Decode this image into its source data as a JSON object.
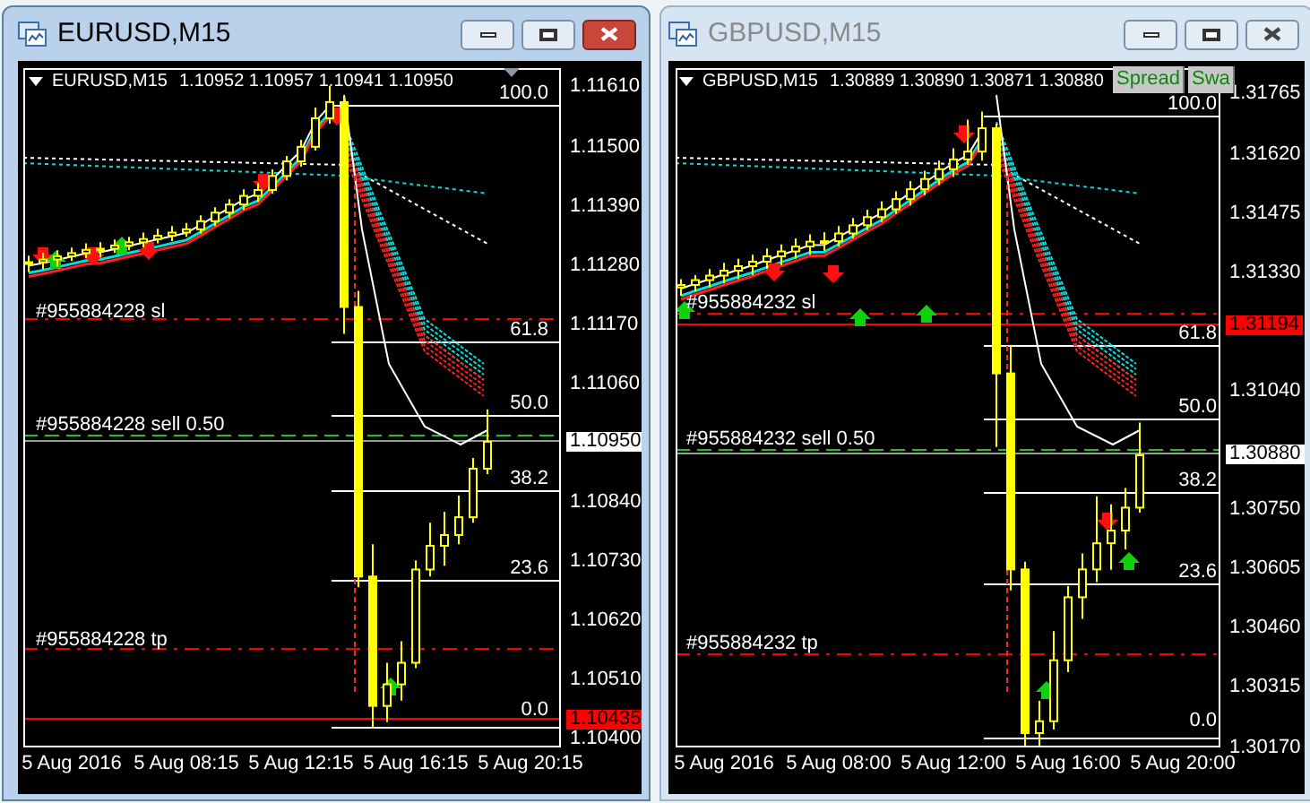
{
  "windows": [
    {
      "title": "EURUSD,M15",
      "active": true,
      "symbol": "EURUSD,M15",
      "quotes": "1.10952 1.10957 1.10941 1.10950",
      "chart_data": {
        "type": "candlestick",
        "ylim": [
          1.10383,
          1.11643
        ],
        "categories": [
          null,
          null,
          null,
          "5 Aug 2016",
          null,
          null,
          null,
          null,
          null,
          null,
          null,
          "5 Aug 08:15",
          null,
          null,
          null,
          null,
          null,
          null,
          null,
          "5 Aug 12:15",
          null,
          null,
          null,
          null,
          null,
          null,
          null,
          "5 Aug 16:15",
          null,
          null,
          null,
          null,
          null,
          null,
          null,
          "5 Aug 20:15"
        ],
        "yticks": [
          {
            "value": 1.1161,
            "label": "1.11610"
          },
          {
            "value": 1.115,
            "label": "1.11500"
          },
          {
            "value": 1.1139,
            "label": "1.11390"
          },
          {
            "value": 1.1128,
            "label": "1.11280"
          },
          {
            "value": 1.1117,
            "label": "1.11170"
          },
          {
            "value": 1.1106,
            "label": "1.11060"
          },
          {
            "value": 1.1084,
            "label": "1.10840"
          },
          {
            "value": 1.1073,
            "label": "1.10730"
          },
          {
            "value": 1.1062,
            "label": "1.10620"
          },
          {
            "value": 1.1051,
            "label": "1.10510"
          },
          {
            "value": 1.104,
            "label": "1.10400"
          }
        ],
        "ohlc": [
          [
            1.1128,
            1.11295,
            1.11265,
            1.11283
          ],
          [
            1.11283,
            1.113,
            1.1127,
            1.11288
          ],
          [
            1.11288,
            1.11305,
            1.11275,
            1.11294
          ],
          [
            1.11294,
            1.1131,
            1.11285,
            1.113
          ],
          [
            1.113,
            1.11318,
            1.1129,
            1.11306
          ],
          [
            1.11306,
            1.1132,
            1.11292,
            1.11308
          ],
          [
            1.11308,
            1.11325,
            1.113,
            1.11314
          ],
          [
            1.11314,
            1.1133,
            1.11305,
            1.1132
          ],
          [
            1.1132,
            1.11338,
            1.1131,
            1.11326
          ],
          [
            1.11326,
            1.11345,
            1.11318,
            1.11332
          ],
          [
            1.11332,
            1.1135,
            1.11322,
            1.11338
          ],
          [
            1.11338,
            1.11356,
            1.1133,
            1.11344
          ],
          [
            1.11344,
            1.1137,
            1.11336,
            1.11359
          ],
          [
            1.11359,
            1.11385,
            1.1135,
            1.11375
          ],
          [
            1.11375,
            1.114,
            1.11365,
            1.1139
          ],
          [
            1.1139,
            1.11418,
            1.1138,
            1.11406
          ],
          [
            1.11406,
            1.1143,
            1.11395,
            1.11417
          ],
          [
            1.11417,
            1.11455,
            1.1141,
            1.11443
          ],
          [
            1.11443,
            1.1148,
            1.11435,
            1.1147
          ],
          [
            1.1147,
            1.1151,
            1.1146,
            1.11497
          ],
          [
            1.11497,
            1.1157,
            1.1149,
            1.1155
          ],
          [
            1.1155,
            1.1161,
            1.1154,
            1.1158
          ],
          [
            1.1158,
            1.1159,
            1.1115,
            1.112
          ],
          [
            1.112,
            1.1123,
            1.1068,
            1.107
          ],
          [
            1.107,
            1.1076,
            1.1042,
            1.1046
          ],
          [
            1.1046,
            1.1054,
            1.1043,
            1.105
          ],
          [
            1.105,
            1.1058,
            1.1047,
            1.1054
          ],
          [
            1.1054,
            1.1073,
            1.1053,
            1.10713
          ],
          [
            1.10713,
            1.108,
            1.107,
            1.10757
          ],
          [
            1.10757,
            1.1082,
            1.1072,
            1.10777
          ],
          [
            1.10777,
            1.1085,
            1.1076,
            1.1081
          ],
          [
            1.1081,
            1.1092,
            1.108,
            1.109
          ],
          [
            1.109,
            1.1101,
            1.1089,
            1.1095
          ],
          null,
          null,
          null
        ]
      },
      "price_markers": [
        {
          "text": "1.10950",
          "kind": "bid"
        },
        {
          "text": "1.10435",
          "kind": "line"
        }
      ],
      "fib_levels": [
        "100.0",
        "61.8",
        "50.0",
        "38.2",
        "23.6",
        "0.0"
      ],
      "orders": [
        {
          "text": "#955884228 sl",
          "kind": "sl"
        },
        {
          "text": "#955884228 sell 0.50",
          "kind": "entry"
        },
        {
          "text": "#955884228 tp",
          "kind": "tp"
        }
      ]
    },
    {
      "title": "GBPUSD,M15",
      "active": false,
      "symbol": "GBPUSD,M15",
      "quotes": "1.30889 1.30890 1.30871 1.30880",
      "panel_buttons": [
        "Spread",
        "Swa"
      ],
      "chart_data": {
        "type": "candlestick",
        "ylim": [
          1.30166,
          1.31826
        ],
        "categories": [
          null,
          null,
          null,
          "5 Aug 2016",
          null,
          null,
          null,
          null,
          null,
          null,
          null,
          "5 Aug 08:00",
          null,
          null,
          null,
          null,
          null,
          null,
          null,
          "5 Aug 12:00",
          null,
          null,
          null,
          null,
          null,
          null,
          null,
          "5 Aug 16:00",
          null,
          null,
          null,
          null,
          null,
          null,
          null,
          "5 Aug 20:00"
        ],
        "yticks": [
          {
            "value": 1.31765,
            "label": "1.31765"
          },
          {
            "value": 1.3162,
            "label": "1.31620"
          },
          {
            "value": 1.31475,
            "label": "1.31475"
          },
          {
            "value": 1.3133,
            "label": "1.31330"
          },
          {
            "value": 1.3104,
            "label": "1.31040"
          },
          {
            "value": 1.3075,
            "label": "1.30750"
          },
          {
            "value": 1.30605,
            "label": "1.30605"
          },
          {
            "value": 1.3046,
            "label": "1.30460"
          },
          {
            "value": 1.30315,
            "label": "1.30315"
          },
          {
            "value": 1.3017,
            "label": "1.30170"
          }
        ],
        "ohlc": [
          [
            1.3129,
            1.3131,
            1.3127,
            1.31296
          ],
          [
            1.31296,
            1.3132,
            1.3128,
            1.31308
          ],
          [
            1.31308,
            1.31335,
            1.3129,
            1.31319
          ],
          [
            1.31319,
            1.3135,
            1.313,
            1.31331
          ],
          [
            1.31331,
            1.3136,
            1.3131,
            1.31342
          ],
          [
            1.31342,
            1.3137,
            1.3132,
            1.31353
          ],
          [
            1.31353,
            1.31385,
            1.31335,
            1.31366
          ],
          [
            1.31366,
            1.31395,
            1.31345,
            1.31378
          ],
          [
            1.31378,
            1.3141,
            1.3136,
            1.3139
          ],
          [
            1.3139,
            1.3142,
            1.3137,
            1.31402
          ],
          [
            1.31402,
            1.31425,
            1.3138,
            1.31403
          ],
          [
            1.31403,
            1.3144,
            1.3139,
            1.31422
          ],
          [
            1.31422,
            1.3146,
            1.3141,
            1.31442
          ],
          [
            1.31442,
            1.3148,
            1.3143,
            1.31462
          ],
          [
            1.31462,
            1.315,
            1.3145,
            1.31481
          ],
          [
            1.31481,
            1.31525,
            1.3147,
            1.31506
          ],
          [
            1.31506,
            1.3155,
            1.3149,
            1.3153
          ],
          [
            1.3153,
            1.31575,
            1.31515,
            1.31555
          ],
          [
            1.31555,
            1.316,
            1.3154,
            1.31579
          ],
          [
            1.31579,
            1.3163,
            1.3156,
            1.31603
          ],
          [
            1.31603,
            1.317,
            1.3159,
            1.31622
          ],
          [
            1.31622,
            1.3172,
            1.316,
            1.31679
          ],
          [
            1.31679,
            1.3169,
            1.309,
            1.3108
          ],
          [
            1.3108,
            1.3115,
            1.3055,
            1.30601
          ],
          [
            1.30601,
            1.3062,
            1.3017,
            1.30201
          ],
          [
            1.30201,
            1.3028,
            1.3017,
            1.3023
          ],
          [
            1.3023,
            1.3045,
            1.3021,
            1.30379
          ],
          [
            1.30379,
            1.3056,
            1.3035,
            1.30533
          ],
          [
            1.30533,
            1.3064,
            1.3048,
            1.30601
          ],
          [
            1.30601,
            1.3078,
            1.3057,
            1.30665
          ],
          [
            1.30665,
            1.3076,
            1.306,
            1.30696
          ],
          [
            1.30696,
            1.308,
            1.3065,
            1.30752
          ],
          [
            1.30752,
            1.3096,
            1.3074,
            1.3088
          ],
          null,
          null,
          null
        ]
      },
      "price_markers": [
        {
          "text": "1.31194",
          "kind": "line"
        },
        {
          "text": "1.30880",
          "kind": "bid"
        }
      ],
      "fib_levels": [
        "100.0",
        "61.8",
        "50.0",
        "38.2",
        "23.6",
        "0.0"
      ],
      "orders": [
        {
          "text": "#955884232 sl",
          "kind": "sl"
        },
        {
          "text": "#955884232 sell 0.50",
          "kind": "entry"
        },
        {
          "text": "#955884232 tp",
          "kind": "tp"
        }
      ]
    }
  ]
}
